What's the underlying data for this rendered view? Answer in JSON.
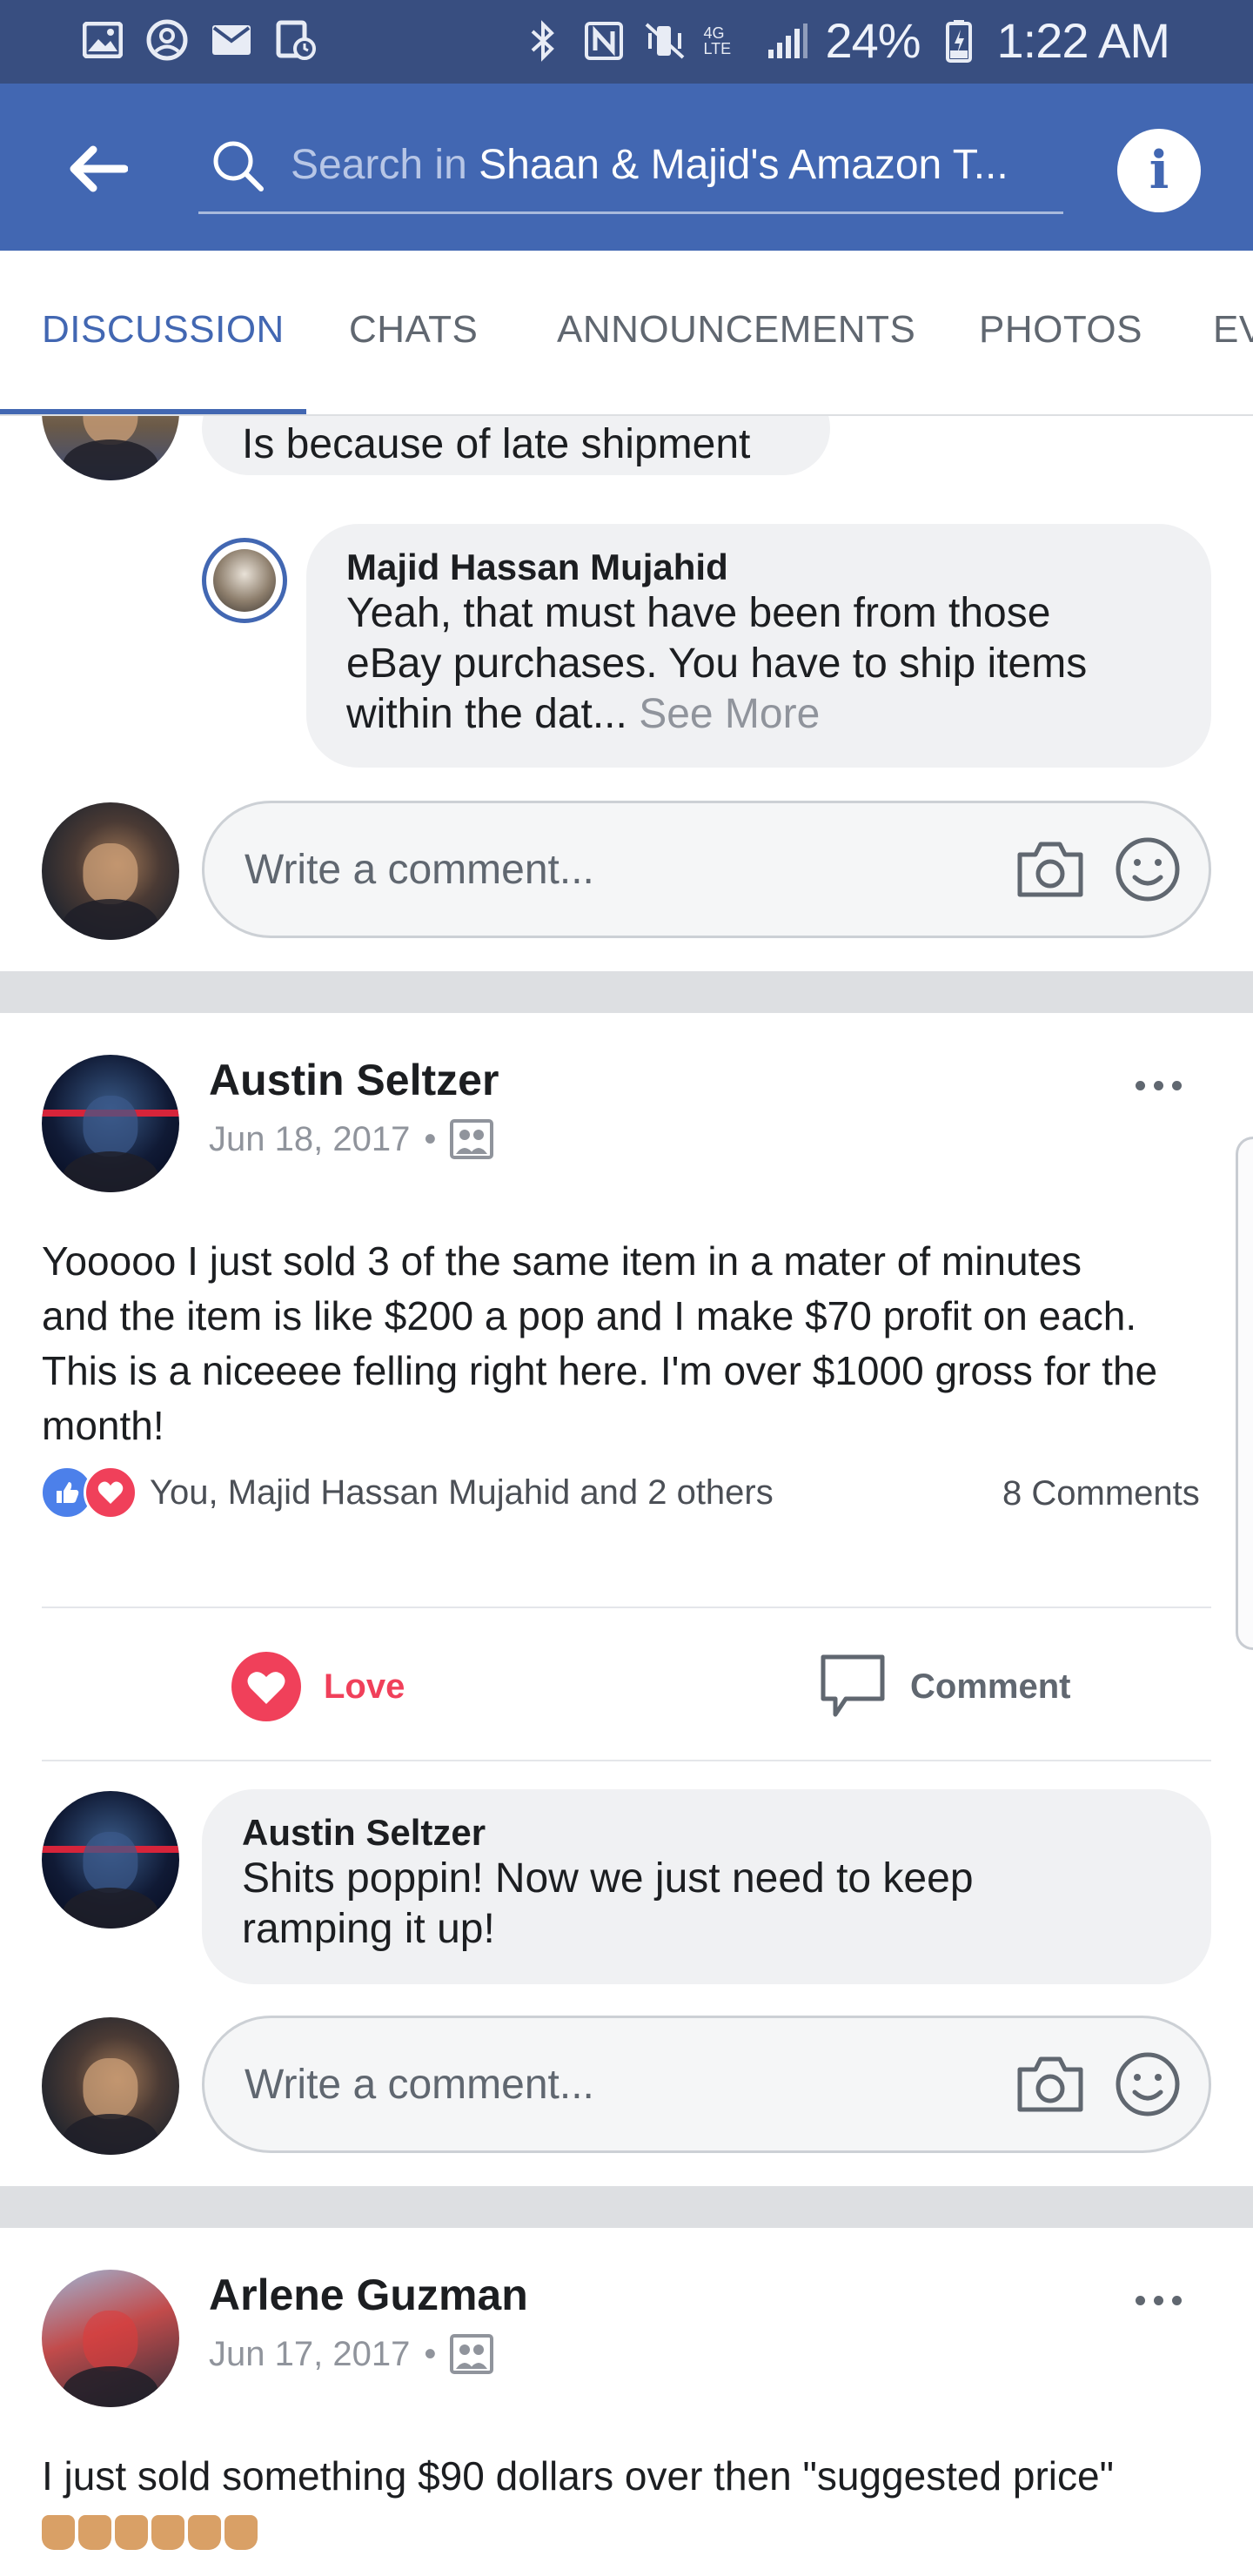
{
  "status_bar": {
    "battery": "24%",
    "time": "1:22 AM",
    "network": "4G LTE"
  },
  "app_bar": {
    "search_prefix": "Search in ",
    "search_group": "Shaan & Majid's Amazon T...",
    "info_label": "i"
  },
  "tabs": [
    "DISCUSSION",
    "CHATS",
    "ANNOUNCEMENTS",
    "PHOTOS",
    "EV"
  ],
  "thread_top": {
    "partial_comment": "Is because of late shipment",
    "reply": {
      "author": "Majid Hassan Mujahid",
      "text_lines": [
        "Yeah, that must have been from those",
        "eBay purchases. You have to ship items",
        "within the dat... "
      ],
      "see_more": "See More"
    },
    "comment_placeholder": "Write a comment..."
  },
  "post1": {
    "author": "Austin Seltzer",
    "date": "Jun 18, 2017",
    "text_lines": [
      "Yooooo I just sold 3 of the same item in a mater of minutes",
      "and the item is like $200 a pop and I make $70 profit on each.",
      "This is a niceeee felling right here. I'm over $1000 gross for the",
      "month!"
    ],
    "reactions_summary": "You, Majid Hassan Mujahid and 2 others",
    "comments_count": "8 Comments",
    "love_label": "Love",
    "comment_label": "Comment",
    "comment": {
      "author": "Austin Seltzer",
      "text_lines": [
        "Shits poppin! Now we just need to keep",
        "ramping it up!"
      ]
    },
    "comment_placeholder": "Write a comment..."
  },
  "post2": {
    "author": "Arlene Guzman",
    "date": "Jun 17, 2017",
    "text": "I just sold something $90 dollars over then \"suggested price\""
  },
  "colors": {
    "status_bar": "#384e80",
    "brand_blue": "#4267b2",
    "love_red": "#f0405a",
    "like_blue": "#4c80ea"
  }
}
